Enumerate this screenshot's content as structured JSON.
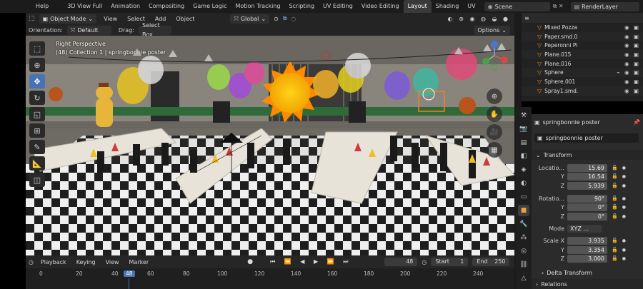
{
  "topbar": {
    "menu": [
      "Help"
    ],
    "workspaces": [
      "3D View Full",
      "Animation",
      "Compositing",
      "Game Logic",
      "Motion Tracking",
      "Scripting",
      "UV Editing",
      "Video Editing",
      "Layout",
      "Shading",
      "UV"
    ],
    "active_workspace": "Layout",
    "scene": "Scene",
    "render_layer": "RenderLayer"
  },
  "viewport_header": {
    "mode": "Object Mode",
    "menus": [
      "View",
      "Select",
      "Add",
      "Object"
    ],
    "transform_orientation": "Global",
    "orientation_label": "Orientation:",
    "orientation_value": "Default",
    "drag_label": "Drag:",
    "drag_value": "Select Box",
    "options": "Options"
  },
  "viewport": {
    "perspective": "Right Perspective",
    "collection_info": "(48) Collection 1 | springbonnie poster"
  },
  "timeline": {
    "menus": [
      "Playback",
      "Keying",
      "View",
      "Marker"
    ],
    "current_frame": "48",
    "start_label": "Start",
    "start": "1",
    "end_label": "End",
    "end": "250",
    "ticks": [
      "0",
      "20",
      "40",
      "48",
      "60",
      "80",
      "100",
      "120",
      "140",
      "160",
      "180",
      "200",
      "220",
      "240"
    ]
  },
  "outliner": {
    "items": [
      "Mixed Pozza",
      "Paper.smd.0",
      "Peperonni Pi",
      "Plane.015",
      "Plane.016",
      "Sphere",
      "Sphere.001",
      "Spray1.smd."
    ]
  },
  "properties": {
    "object_name": "springbonnie poster",
    "data_name": "springbonnie poster",
    "transform_header": "Transform",
    "location_label": "Locatio...",
    "location": [
      "15.69",
      "16.54",
      "5.939"
    ],
    "rotation_label": "Rotatio...",
    "rotation": [
      "90°",
      "0°",
      "0°"
    ],
    "mode_label": "Mode",
    "mode_value": "XYZ ...",
    "scale_label": "Scale X",
    "scale": [
      "3.935",
      "3.354",
      "3.000"
    ],
    "axis_y": "Y",
    "axis_z": "Z",
    "delta_header": "Delta Transform",
    "relations_header": "Relations"
  },
  "colors": {
    "accent": "#4772b3",
    "object_orange": "#e08b2a",
    "panel": "#2b2b2b"
  }
}
